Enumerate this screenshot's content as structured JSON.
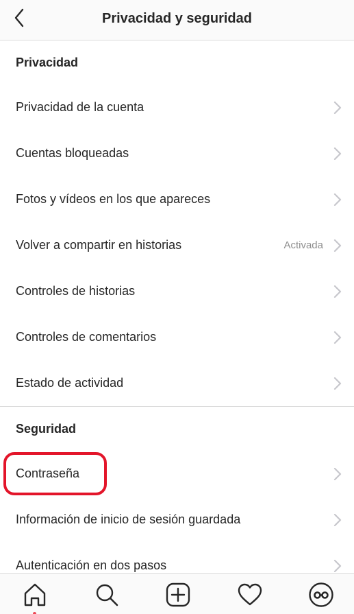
{
  "header": {
    "title": "Privacidad y seguridad"
  },
  "sections": [
    {
      "title": "Privacidad",
      "items": [
        {
          "label": "Privacidad de la cuenta"
        },
        {
          "label": "Cuentas bloqueadas"
        },
        {
          "label": "Fotos y vídeos en los que apareces"
        },
        {
          "label": "Volver a compartir en historias",
          "value": "Activada"
        },
        {
          "label": "Controles de historias"
        },
        {
          "label": "Controles de comentarios"
        },
        {
          "label": "Estado de actividad"
        }
      ]
    },
    {
      "title": "Seguridad",
      "items": [
        {
          "label": "Contraseña"
        },
        {
          "label": "Información de inicio de sesión guardada"
        },
        {
          "label": "Autenticación en dos pasos"
        }
      ]
    }
  ],
  "tabbar": {
    "items": [
      "home-icon",
      "search-icon",
      "new-post-icon",
      "activity-heart-icon",
      "profile-icon"
    ],
    "active": "home-icon"
  },
  "colors": {
    "highlight_outline": "#e3152a",
    "notification_dot": "#ed4956",
    "chevron": "#c7c7cc",
    "secondary_text": "#8e8e8e"
  }
}
